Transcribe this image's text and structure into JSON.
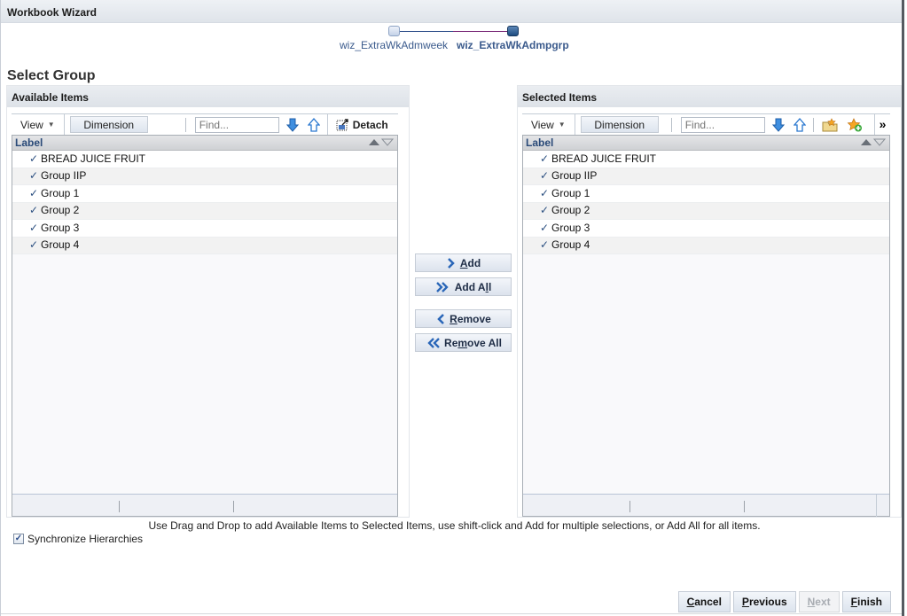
{
  "window": {
    "title": "Workbook Wizard"
  },
  "train": {
    "steps": [
      {
        "label": "wiz_ExtraWkAdmweek",
        "state": "visited"
      },
      {
        "label": "wiz_ExtraWkAdmpgrp",
        "state": "current"
      }
    ]
  },
  "page": {
    "title": "Select Group"
  },
  "available": {
    "header": "Available Items",
    "toolbar": {
      "view_label": "View",
      "dimension_label": "Dimension",
      "find_placeholder": "Find...",
      "detach_label": "Detach"
    },
    "column_header": "Label",
    "items": [
      {
        "label": "BREAD JUICE FRUIT"
      },
      {
        "label": "Group IIP"
      },
      {
        "label": "Group 1"
      },
      {
        "label": "Group 2"
      },
      {
        "label": "Group 3"
      },
      {
        "label": "Group 4"
      }
    ]
  },
  "selected": {
    "header": "Selected Items",
    "toolbar": {
      "view_label": "View",
      "dimension_label": "Dimension",
      "find_placeholder": "Find...",
      "more_label": "»"
    },
    "column_header": "Label",
    "items": [
      {
        "label": "BREAD JUICE FRUIT"
      },
      {
        "label": "Group IIP"
      },
      {
        "label": "Group 1"
      },
      {
        "label": "Group 2"
      },
      {
        "label": "Group 3"
      },
      {
        "label": "Group 4"
      }
    ]
  },
  "shuttle": {
    "add": {
      "pre": "",
      "accel": "A",
      "post": "dd"
    },
    "add_all": {
      "pre": "Add A",
      "accel": "l",
      "post": "l"
    },
    "remove": {
      "pre": "",
      "accel": "R",
      "post": "emove"
    },
    "remove_all": {
      "pre": "Re",
      "accel": "m",
      "post": "ove All"
    }
  },
  "instructions": "Use Drag and Drop to add Available Items to Selected Items, use shift-click and Add for multiple selections, or Add All for all items.",
  "sync": {
    "label": "Synchronize Hierarchies",
    "checked": true,
    "check_glyph": "✓"
  },
  "footer": {
    "cancel": {
      "accel": "C",
      "rest": "ancel"
    },
    "previous": {
      "accel": "P",
      "rest": "revious"
    },
    "next": {
      "accel": "N",
      "rest": "ext",
      "disabled": true
    },
    "finish": {
      "accel": "F",
      "rest": "inish"
    }
  },
  "glyphs": {
    "check": "✓",
    "caret": "▼"
  }
}
